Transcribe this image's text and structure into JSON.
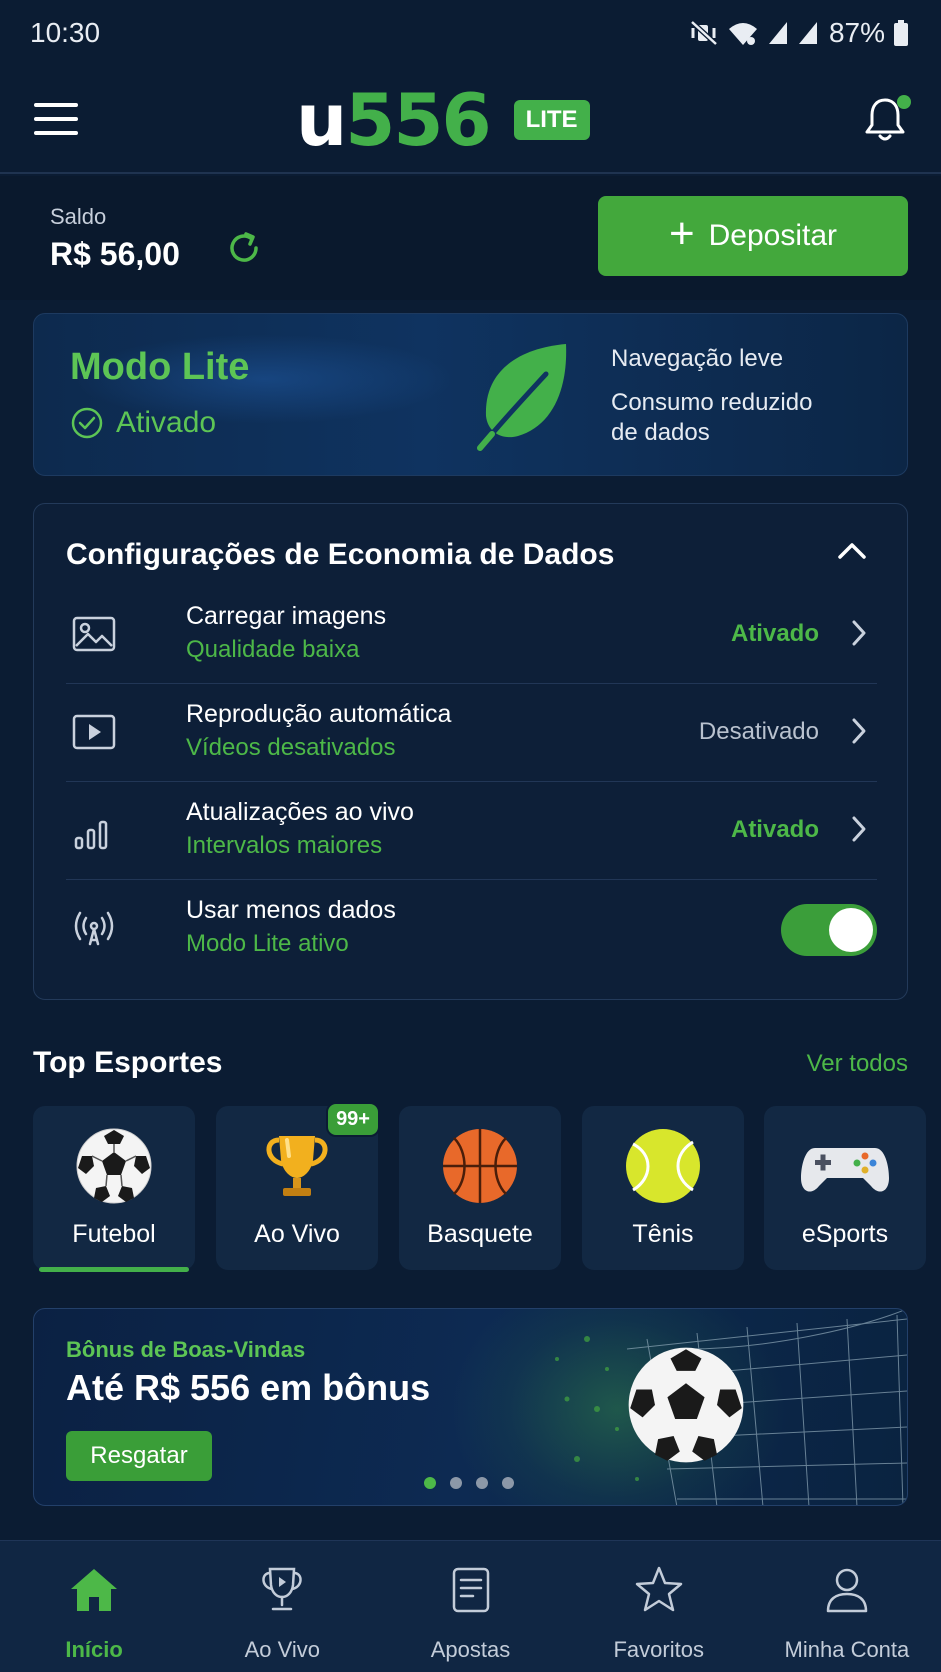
{
  "status_bar": {
    "time": "10:30",
    "battery": "87%"
  },
  "header": {
    "logo_u": "u",
    "logo_number": "556",
    "badge": "LITE",
    "accent_color": "#43b04a"
  },
  "balance": {
    "label": "Saldo",
    "value": "R$ 56,00",
    "deposit_label": "Depositar"
  },
  "lite_mode": {
    "title": "Modo Lite",
    "status": "Ativado",
    "feature_1": "Navegação leve",
    "feature_2_line1": "Consumo reduzido",
    "feature_2_line2": "de dados"
  },
  "data_settings": {
    "title": "Configurações de Economia de Dados",
    "items": [
      {
        "icon": "image-icon",
        "title": "Carregar imagens",
        "subtitle": "Qualidade baixa",
        "status": "Ativado"
      },
      {
        "icon": "play-video-icon",
        "title": "Reprodução automática",
        "subtitle": "Vídeos desativados",
        "status": "Desativado"
      },
      {
        "icon": "bar-chart-icon",
        "title": "Atualizações ao vivo",
        "subtitle": "Intervalos maiores",
        "status": "Ativado"
      },
      {
        "icon": "signal-tower-icon",
        "title": "Usar menos dados",
        "subtitle": "Modo Lite ativo",
        "toggle_on": true
      }
    ]
  },
  "top_sports": {
    "title": "Top Esportes",
    "see_all": "Ver todos",
    "items": [
      {
        "icon": "soccer-ball-icon",
        "label": "Futebol",
        "selected": true
      },
      {
        "icon": "trophy-icon",
        "label": "Ao Vivo",
        "badge": "99+"
      },
      {
        "icon": "basketball-icon",
        "label": "Basquete"
      },
      {
        "icon": "tennis-ball-icon",
        "label": "Tênis"
      },
      {
        "icon": "gamepad-icon",
        "label": "eSports"
      }
    ]
  },
  "banner": {
    "kicker": "Bônus de Boas-Vindas",
    "title": "Até R$ 556 em bônus",
    "button": "Resgatar",
    "slides": 4,
    "active_slide": 1
  },
  "bottom_nav": {
    "items": [
      {
        "icon": "home-icon",
        "label": "Início",
        "active": true
      },
      {
        "icon": "live-trophy-icon",
        "label": "Ao Vivo"
      },
      {
        "icon": "bets-ticket-icon",
        "label": "Apostas"
      },
      {
        "icon": "star-icon",
        "label": "Favoritos"
      },
      {
        "icon": "user-icon",
        "label": "Minha Conta"
      }
    ]
  }
}
